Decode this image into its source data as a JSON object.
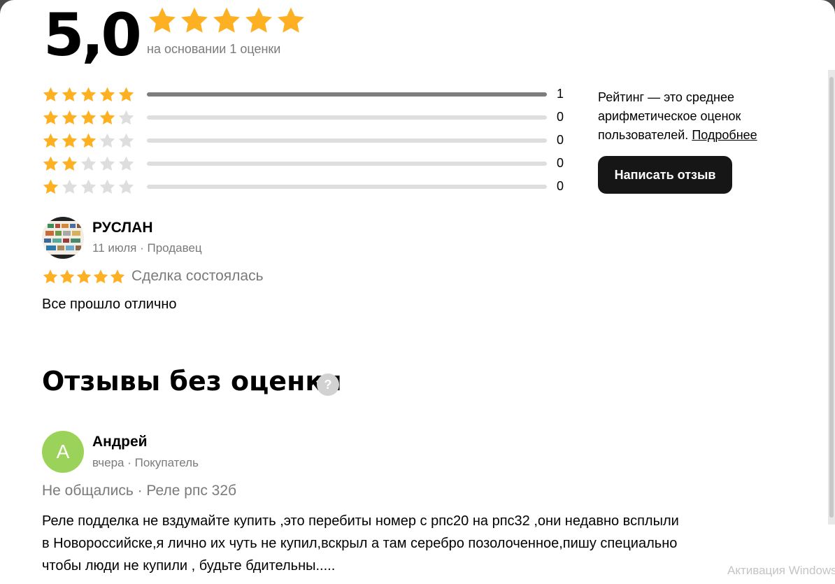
{
  "colors": {
    "star_active": "#FDB022",
    "star_inactive": "#DEDEDE",
    "bar_fill": "#7D7D7D",
    "bar_track": "#DEDEDE",
    "button_bg": "#161616",
    "avatar_andrey": "#9BD35A"
  },
  "summary": {
    "rating": "5,0",
    "stars": 5,
    "basis": "на основании 1 оценки"
  },
  "distribution": [
    {
      "stars": 5,
      "count": "1",
      "fraction": 1.0
    },
    {
      "stars": 4,
      "count": "0",
      "fraction": 0
    },
    {
      "stars": 3,
      "count": "0",
      "fraction": 0
    },
    {
      "stars": 2,
      "count": "0",
      "fraction": 0
    },
    {
      "stars": 1,
      "count": "0",
      "fraction": 0
    }
  ],
  "info": {
    "text": "Рейтинг — это среднее арифметическое оценок пользователей.",
    "link": "Подробнее",
    "button": "Написать отзыв"
  },
  "review1": {
    "name": "РУСЛАН",
    "meta": "11 июля · Продавец",
    "stars": 5,
    "status": "Сделка состоялась",
    "text": "Все прошло отлично"
  },
  "unrated": {
    "title": "Отзывы без оценки",
    "help": "?"
  },
  "review2": {
    "avatar_letter": "А",
    "name": "Андрей",
    "meta": "вчера · Покупатель",
    "sub": "Не общались · Реле рпс 32б",
    "lines": [
      "Реле подделка не вздумайте купить ,это перебиты номер с рпс20 на рпс32 ,они недавно всплыли",
      "в Новороссийске,я лично их чуть не купил,вскрыл а там серебро позолоченное,пишу специально",
      "чтобы люди не купили , будьте бдительны....."
    ]
  },
  "watermark": "Активация Windows"
}
